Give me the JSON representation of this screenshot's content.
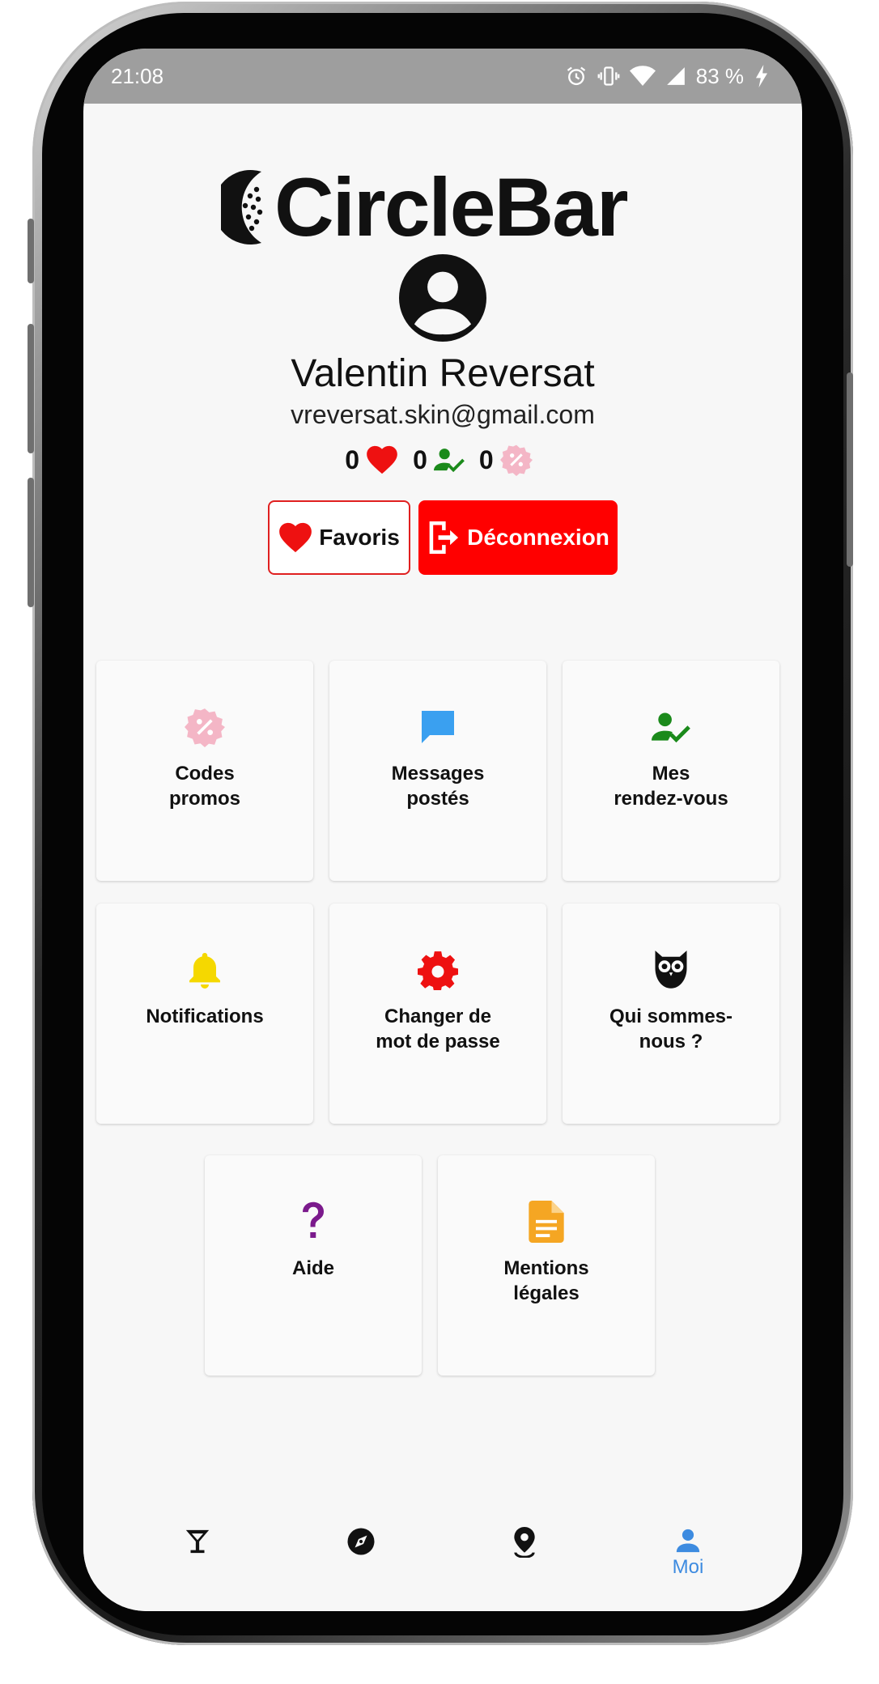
{
  "status_bar": {
    "time": "21:08",
    "battery": "83 %"
  },
  "app": {
    "logo_text": "CircleBar"
  },
  "profile": {
    "name": "Valentin Reversat",
    "email": "vreversat.skin@gmail.com",
    "stats": [
      {
        "value": "0",
        "icon": "heart-icon"
      },
      {
        "value": "0",
        "icon": "person-check-icon"
      },
      {
        "value": "0",
        "icon": "promo-badge-icon"
      }
    ]
  },
  "buttons": {
    "favorites": "Favoris",
    "logout": "Déconnexion"
  },
  "menu": [
    {
      "label": "Codes\npromos",
      "icon": "promo-badge-icon",
      "color": "#f4b6c6"
    },
    {
      "label": "Messages\npostés",
      "icon": "chat-icon",
      "color": "#3aa0f0"
    },
    {
      "label": "Mes\nrendez-vous",
      "icon": "person-check-icon",
      "color": "#1b8a1b"
    },
    {
      "label": "Notifications",
      "icon": "bell-icon",
      "color": "#f5d800"
    },
    {
      "label": "Changer de\nmot de passe",
      "icon": "gear-icon",
      "color": "#ee1111"
    },
    {
      "label": "Qui sommes-\nnous ?",
      "icon": "owl-icon",
      "color": "#111111"
    },
    {
      "label": "Aide",
      "icon": "question-icon",
      "color": "#7b1a8c"
    },
    {
      "label": "Mentions\nlégales",
      "icon": "document-icon",
      "color": "#f5a623"
    }
  ],
  "bottom_nav": [
    {
      "icon": "cocktail-icon",
      "label": ""
    },
    {
      "icon": "compass-icon",
      "label": ""
    },
    {
      "icon": "map-pin-icon",
      "label": ""
    },
    {
      "icon": "person-icon",
      "label": "Moi",
      "active": true
    }
  ],
  "colors": {
    "accent": "#3d8be0",
    "danger": "#ff0000",
    "status_bar": "#9e9e9e"
  }
}
